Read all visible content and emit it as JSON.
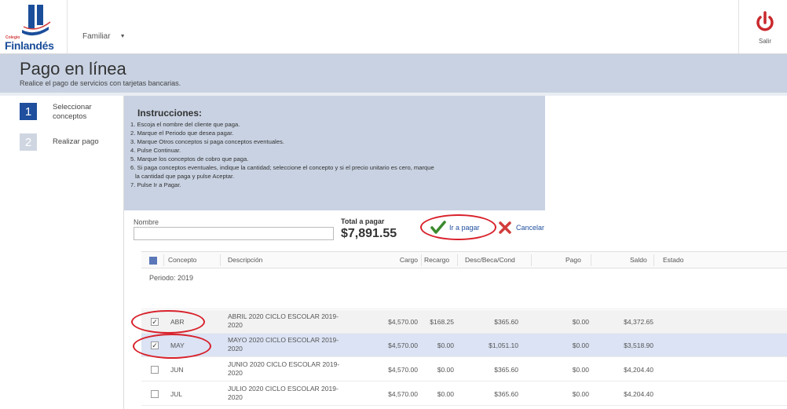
{
  "header": {
    "logo_small": "Colegio",
    "logo_text": "Finlandés",
    "client_selected": "Familiar",
    "logout_label": "Salir"
  },
  "page": {
    "title": "Pago en línea",
    "subtitle": "Realice el pago de servicios con tarjetas bancarias."
  },
  "steps": [
    {
      "number": "1",
      "label": "Seleccionar conceptos",
      "active": true
    },
    {
      "number": "2",
      "label": "Realizar pago",
      "active": false
    }
  ],
  "instructions": {
    "title": "Instrucciones:",
    "items": [
      "1. Escoja el nombre del cliente que paga.",
      "2. Marque el Periodo que desea pagar.",
      "3. Marque Otros conceptos si paga conceptos eventuales.",
      "4. Pulse Continuar.",
      "5. Marque los conceptos de cobro que paga.",
      "6. Si paga conceptos eventuales, indique la cantidad; seleccione el concepto y si el precio unitario es cero, marque",
      "la cantidad que paga y pulse Aceptar.",
      "7. Pulse Ir a Pagar."
    ]
  },
  "form": {
    "nombre_label": "Nombre",
    "nombre_value": "",
    "total_label": "Total a pagar",
    "total_value": "$7,891.55",
    "pay_label": "Ir a pagar",
    "cancel_label": "Cancelar"
  },
  "grid": {
    "columns": [
      "Concepto",
      "Descripción",
      "Cargo",
      "Recargo",
      "Desc/Beca/Cond",
      "Pago",
      "Saldo",
      "Estado"
    ],
    "period_label": "Periodo: 2019",
    "rows": [
      {
        "checked": true,
        "concepto": "ABR",
        "descripcion_1": "ABRIL 2020 CICLO ESCOLAR 2019-",
        "descripcion_2": "2020",
        "cargo": "$4,570.00",
        "recargo": "$168.25",
        "desc": "$365.60",
        "pago": "$0.00",
        "saldo": "$4,372.65",
        "estado": ""
      },
      {
        "checked": true,
        "concepto": "MAY",
        "descripcion_1": "MAYO 2020 CICLO ESCOLAR 2019-",
        "descripcion_2": "2020",
        "cargo": "$4,570.00",
        "recargo": "$0.00",
        "desc": "$1,051.10",
        "pago": "$0.00",
        "saldo": "$3,518.90",
        "estado": ""
      },
      {
        "checked": false,
        "concepto": "JUN",
        "descripcion_1": "JUNIO 2020 CICLO ESCOLAR 2019-",
        "descripcion_2": "2020",
        "cargo": "$4,570.00",
        "recargo": "$0.00",
        "desc": "$365.60",
        "pago": "$0.00",
        "saldo": "$4,204.40",
        "estado": ""
      },
      {
        "checked": false,
        "concepto": "JUL",
        "descripcion_1": "JULIO 2020 CICLO ESCOLAR 2019-",
        "descripcion_2": "2020",
        "cargo": "$4,570.00",
        "recargo": "$0.00",
        "desc": "$365.60",
        "pago": "$0.00",
        "saldo": "$4,204.40",
        "estado": ""
      }
    ]
  },
  "colors": {
    "accent": "#1f4f9d",
    "band": "#c8d2e2",
    "highlight": "#d8202a",
    "selected_row": "#dbe3f4"
  }
}
